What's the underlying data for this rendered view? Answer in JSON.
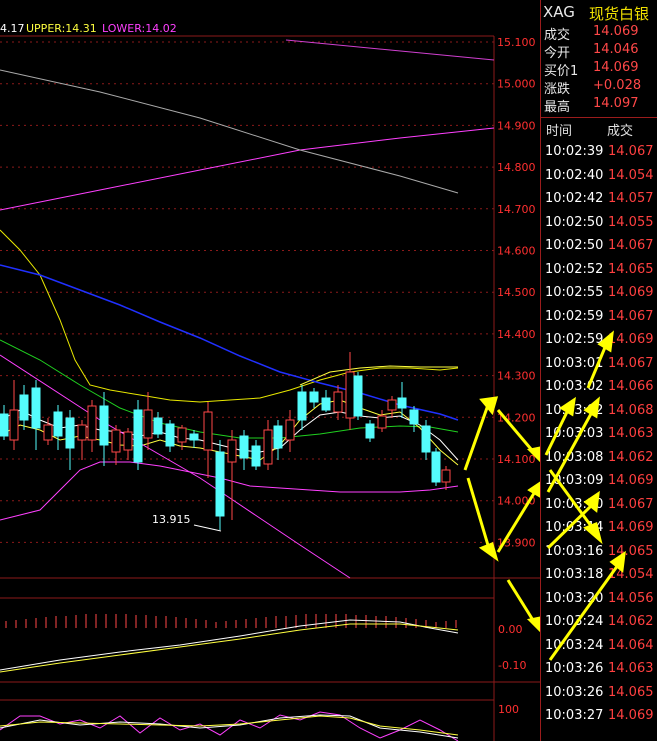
{
  "legend": {
    "left_value": "4.17",
    "upper": "UPPER:14.31",
    "lower": "LOWER:14.02"
  },
  "price_axis": [
    "15.100",
    "15.000",
    "14.900",
    "14.800",
    "14.700",
    "14.600",
    "14.500",
    "14.400",
    "14.300",
    "14.200",
    "14.100",
    "14.000",
    "13.900"
  ],
  "low_label": "13.915",
  "macd_axis": [
    "0.00",
    "-0.10"
  ],
  "kdj_axis": [
    "100"
  ],
  "side": {
    "symbol": "XAG",
    "name": "现货白银",
    "quotes": [
      {
        "label": "成交",
        "value": "14.069"
      },
      {
        "label": "今开",
        "value": "14.046"
      },
      {
        "label": "买价1",
        "value": "14.069"
      },
      {
        "label": "涨跌",
        "value": "+0.028"
      },
      {
        "label": "最高",
        "value": "14.097"
      }
    ],
    "col_time": "时间",
    "col_price": "成交",
    "ticks": [
      {
        "t": "10:02:39",
        "p": "14.067"
      },
      {
        "t": "10:02:40",
        "p": "14.054"
      },
      {
        "t": "10:02:42",
        "p": "14.057"
      },
      {
        "t": "10:02:50",
        "p": "14.055"
      },
      {
        "t": "10:02:50",
        "p": "14.067"
      },
      {
        "t": "10:02:52",
        "p": "14.065"
      },
      {
        "t": "10:02:55",
        "p": "14.069"
      },
      {
        "t": "10:02:59",
        "p": "14.067"
      },
      {
        "t": "10:02:59",
        "p": "14.069"
      },
      {
        "t": "10:03:01",
        "p": "14.067"
      },
      {
        "t": "10:03:02",
        "p": "14.066"
      },
      {
        "t": "10:03:02",
        "p": "14.068"
      },
      {
        "t": "10:03:03",
        "p": "14.063"
      },
      {
        "t": "10:03:08",
        "p": "14.062"
      },
      {
        "t": "10:03:09",
        "p": "14.069"
      },
      {
        "t": "10:03:10",
        "p": "14.067"
      },
      {
        "t": "10:03:14",
        "p": "14.069"
      },
      {
        "t": "10:03:16",
        "p": "14.065"
      },
      {
        "t": "10:03:18",
        "p": "14.054"
      },
      {
        "t": "10:03:20",
        "p": "14.056"
      },
      {
        "t": "10:03:24",
        "p": "14.062"
      },
      {
        "t": "10:03:24",
        "p": "14.064"
      },
      {
        "t": "10:03:26",
        "p": "14.063"
      },
      {
        "t": "10:03:26",
        "p": "14.065"
      },
      {
        "t": "10:03:27",
        "p": "14.069"
      }
    ]
  },
  "colors": {
    "bull": "#54fcfc",
    "bear": "#ff4848",
    "grid": "#8b1a1a",
    "axis_text": "#ff3030",
    "upper_line": "#ffff40",
    "lower_line": "#ff40ff",
    "arrow": "#ffff00"
  }
}
